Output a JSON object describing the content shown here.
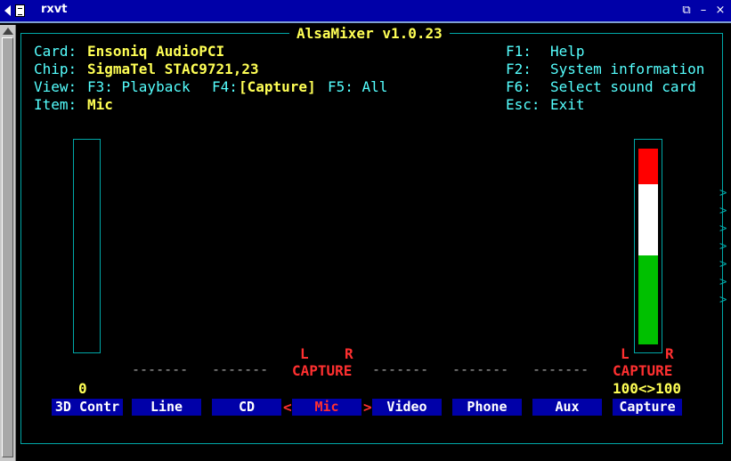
{
  "window": {
    "title": "rxvt",
    "buttons": {
      "restore": "⧉",
      "minimize": "–",
      "close": "×"
    }
  },
  "app": {
    "title": "AlsaMixer v1.0.23"
  },
  "info": {
    "card_label": "Card:",
    "card_value": "Ensoniq AudioPCI",
    "chip_label": "Chip:",
    "chip_value": "SigmaTel STAC9721,23",
    "view_label": "View:",
    "view_f3": "F3: Playback",
    "view_f4_key": "F4:",
    "view_f4_value": "[Capture]",
    "view_f5": "F5: All",
    "item_label": "Item:",
    "item_value": "Mic"
  },
  "help": [
    {
      "key": "F1:",
      "text": "Help"
    },
    {
      "key": "F2:",
      "text": "System information"
    },
    {
      "key": "F6:",
      "text": "Select sound card"
    },
    {
      "key": "Esc:",
      "text": "Exit"
    }
  ],
  "controls": [
    {
      "name": "3D Contr",
      "value_text": "0",
      "capture": "--------",
      "left": "",
      "right": ""
    },
    {
      "name": "Line",
      "capture": "-------"
    },
    {
      "name": "CD",
      "capture": "-------"
    },
    {
      "name": "Mic",
      "capture": "CAPTURE",
      "left": "L",
      "right": "R",
      "selected": true
    },
    {
      "name": "Video",
      "capture": "-------"
    },
    {
      "name": "Phone",
      "capture": "-------"
    },
    {
      "name": "Aux",
      "capture": "-------"
    },
    {
      "name": "Capture",
      "capture": "CAPTURE",
      "left": "L",
      "right": "R",
      "value_text": "100<>100",
      "level": 1.0
    }
  ],
  "selection_chevrons": {
    "left": "<",
    "right": ">"
  },
  "more_indicator": ">",
  "colors": {
    "frame": "#00a8a8",
    "label": "#55ffff",
    "value": "#ffff55",
    "accent_red": "#ff3030",
    "channel_bg": "#0000a8",
    "meter_red": "#ff0000",
    "meter_white": "#ffffff",
    "meter_green": "#00c000"
  }
}
